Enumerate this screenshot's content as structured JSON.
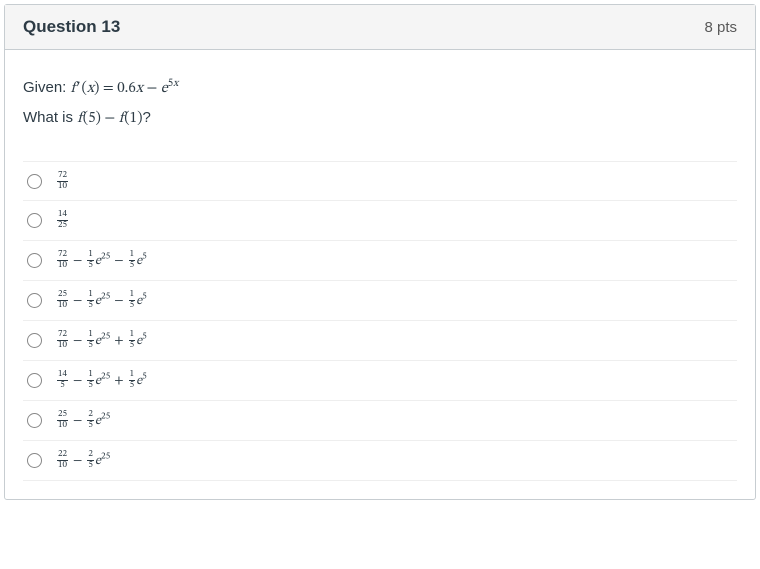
{
  "header": {
    "title": "Question 13",
    "points": "8 pts"
  },
  "prompt": {
    "line1_prefix": "Given: ",
    "line1_math": "<span class=\"math\"><i>f</i>&#8202;&prime;&#8202;(<i>x</i>) = 0.6<i>x</i> &minus; <i>e</i><sup>5<i>x</i></sup></span>",
    "line2_prefix": "What is ",
    "line2_math": "<span class=\"math\"><i>f</i>&#8202;(5) &minus; <i>f</i>&#8202;(1)</span>",
    "line2_suffix": "?"
  },
  "options": [
    {
      "html": "<span class=\"math\"><span class=\"frac\"><span class=\"num\">72</span><span class=\"den\">10</span></span></span>"
    },
    {
      "html": "<span class=\"math\"><span class=\"frac\"><span class=\"num\">14</span><span class=\"den\">25</span></span></span>"
    },
    {
      "html": "<span class=\"math\"><span class=\"frac\"><span class=\"num\">72</span><span class=\"den\">10</span></span><span class=\"op\">&minus;</span><span class=\"frac\"><span class=\"num\">1</span><span class=\"den\">5</span></span><i>e</i><sup>25</sup><span class=\"op\">&minus;</span><span class=\"frac\"><span class=\"num\">1</span><span class=\"den\">5</span></span><i>e</i><sup>5</sup></span>"
    },
    {
      "html": "<span class=\"math\"><span class=\"frac\"><span class=\"num\">25</span><span class=\"den\">10</span></span><span class=\"op\">&minus;</span><span class=\"frac\"><span class=\"num\">1</span><span class=\"den\">5</span></span><i>e</i><sup>25</sup><span class=\"op\">&minus;</span><span class=\"frac\"><span class=\"num\">1</span><span class=\"den\">5</span></span><i>e</i><sup>5</sup></span>"
    },
    {
      "html": "<span class=\"math\"><span class=\"frac\"><span class=\"num\">72</span><span class=\"den\">10</span></span><span class=\"op\">&minus;</span><span class=\"frac\"><span class=\"num\">1</span><span class=\"den\">5</span></span><i>e</i><sup>25</sup><span class=\"op\">+</span><span class=\"frac\"><span class=\"num\">1</span><span class=\"den\">5</span></span><i>e</i><sup>5</sup></span>"
    },
    {
      "html": "<span class=\"math\"><span class=\"frac\"><span class=\"num\">14</span><span class=\"den\">5</span></span><span class=\"op\">&minus;</span><span class=\"frac\"><span class=\"num\">1</span><span class=\"den\">5</span></span><i>e</i><sup>25</sup><span class=\"op\">+</span><span class=\"frac\"><span class=\"num\">1</span><span class=\"den\">5</span></span><i>e</i><sup>5</sup></span>"
    },
    {
      "html": "<span class=\"math\"><span class=\"frac\"><span class=\"num\">25</span><span class=\"den\">10</span></span><span class=\"op\">&minus;</span><span class=\"frac\"><span class=\"num\">2</span><span class=\"den\">5</span></span><i>e</i><sup>25</sup></span>"
    },
    {
      "html": "<span class=\"math\"><span class=\"frac\"><span class=\"num\">22</span><span class=\"den\">10</span></span><span class=\"op\">&minus;</span><span class=\"frac\"><span class=\"num\">2</span><span class=\"den\">5</span></span><i>e</i><sup>25</sup></span>"
    }
  ]
}
